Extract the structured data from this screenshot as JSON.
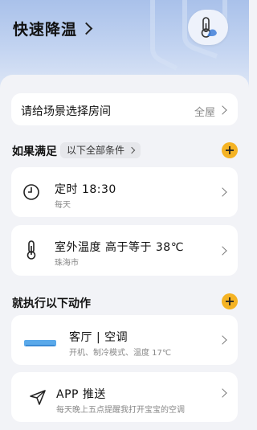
{
  "header": {
    "title": "快速降温"
  },
  "room": {
    "label": "请给场景选择房间",
    "value": "全屋"
  },
  "conditions": {
    "label": "如果满足",
    "mode_label": "以下全部条件",
    "items": [
      {
        "title": "定时 18:30",
        "subtitle": "每天",
        "icon": "clock-icon"
      },
      {
        "title": "室外温度  高于等于 38℃",
        "subtitle": "珠海市",
        "icon": "thermometer-icon"
      }
    ]
  },
  "actions": {
    "label": "就执行以下动作",
    "items": [
      {
        "title": "客厅 | 空调",
        "subtitle": "开机、制冷模式、温度 17℃",
        "icon": "air-conditioner-icon"
      },
      {
        "title": "APP 推送",
        "subtitle": "每天晚上五点提醒我打开宝宝的空调",
        "icon": "send-icon"
      }
    ]
  },
  "colors": {
    "accent": "#f5b324",
    "header_top": "#a9c1ea",
    "background": "#f2f3f7",
    "ac_blue": "#5aa9ea"
  }
}
